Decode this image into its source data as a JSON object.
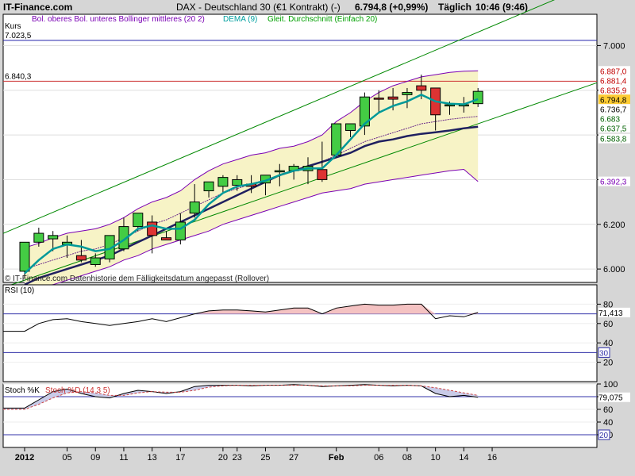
{
  "header": {
    "site": "IT-Finance.com",
    "instrument": "DAX - Deutschland 30 (€1 Kontrakt) (-)",
    "quote": "6.794,8 (+0,99%)",
    "timeframe": "Täglich",
    "time": "10:46 (9:46)"
  },
  "price_panel": {
    "ylabel": "Kurs",
    "legend": [
      {
        "text": "Bol. oberes Bol. unteres Bollinger mittleres (20 2)",
        "color": "#7a00b4"
      },
      {
        "text": "DEMA (9)",
        "color": "#00a0a0"
      },
      {
        "text": "Gleit. Durchschnitt (Einfach 20)",
        "color": "#00a000"
      }
    ],
    "hline_upper_label": "7.023,5",
    "hline_lower_label": "6.840,3",
    "copyright": "© IT-Finance.com  Datenhistorie dem Fälligkeitsdatum angepasst (Rollover)",
    "right_labels": [
      {
        "text": "6.887,0",
        "value": 6887.0,
        "bg": "#ffffff",
        "fg": "#c00000"
      },
      {
        "text": "6.881,4",
        "value": 6881.4,
        "bg": "#ffffff",
        "fg": "#c00000"
      },
      {
        "text": "6.835,9",
        "value": 6835.9,
        "bg": "#ffffff",
        "fg": "#c00000"
      },
      {
        "text": "6.794,8",
        "value": 6794.8,
        "bg": "#ffcc33",
        "fg": "#000000"
      },
      {
        "text": "6.736,7",
        "value": 6736.7,
        "bg": "#ffffff",
        "fg": "#000000"
      },
      {
        "text": "6.683",
        "value": 6683.0,
        "bg": "#ffffff",
        "fg": "#006000"
      },
      {
        "text": "6.637,5",
        "value": 6637.5,
        "bg": "#ffffff",
        "fg": "#006000"
      },
      {
        "text": "6.583,8",
        "value": 6583.8,
        "bg": "#ffffff",
        "fg": "#006000"
      },
      {
        "text": "6.392,3",
        "value": 6392.3,
        "bg": "#ffffff",
        "fg": "#7a00b4"
      }
    ]
  },
  "rsi_panel": {
    "label": "RSI (10)",
    "value_label": "71,413",
    "level_label": "30"
  },
  "stoch_panel": {
    "label_k": "Stoch %K",
    "label_d": "Stoch %D (14 3 5)",
    "value_label": "79,075",
    "level_label": "20"
  },
  "colors": {
    "up": "#44cc44",
    "down": "#dd3333",
    "bollinger": "#7a00b4",
    "dema": "#009999",
    "channel": "#008800",
    "band_fill": "#f7f3c6"
  },
  "chart_data": [
    {
      "type": "candlestick",
      "title": "DAX - Deutschland 30 (€1 Kontrakt) (-)",
      "ylabel": "Kurs",
      "yaxis_ticks": [
        6000,
        6200,
        6400,
        6600,
        6800,
        7000
      ],
      "yaxis_tick_labels": [
        "6.000",
        "6.200",
        "",
        "",
        "",
        "7.000"
      ],
      "ylim": [
        5940,
        7140
      ],
      "xaxis_tick_labels": [
        "2012",
        "05",
        "09",
        "11",
        "13",
        "17",
        "20",
        "23",
        "25",
        "27",
        "Feb",
        "06",
        "08",
        "10",
        "14",
        "16"
      ],
      "dates": [
        "2012-01-02",
        "2012-01-03",
        "2012-01-04",
        "2012-01-05",
        "2012-01-06",
        "2012-01-09",
        "2012-01-10",
        "2012-01-11",
        "2012-01-12",
        "2012-01-13",
        "2012-01-16",
        "2012-01-17",
        "2012-01-18",
        "2012-01-19",
        "2012-01-20",
        "2012-01-23",
        "2012-01-24",
        "2012-01-25",
        "2012-01-26",
        "2012-01-27",
        "2012-01-30",
        "2012-01-31",
        "2012-02-01",
        "2012-02-02",
        "2012-02-03",
        "2012-02-06",
        "2012-02-07",
        "2012-02-08",
        "2012-02-09",
        "2012-02-10",
        "2012-02-13",
        "2012-02-14",
        "2012-02-15"
      ],
      "open": [
        5990,
        6120,
        6135,
        6110,
        6060,
        6020,
        6045,
        6090,
        6190,
        6210,
        6140,
        6130,
        6250,
        6350,
        6370,
        6375,
        6380,
        6385,
        6440,
        6440,
        6440,
        6445,
        6510,
        6620,
        6640,
        6765,
        6770,
        6780,
        6820,
        6810,
        6730,
        6730,
        6740
      ],
      "high": [
        6080,
        6185,
        6170,
        6150,
        6130,
        6070,
        6150,
        6230,
        6230,
        6240,
        6170,
        6250,
        6380,
        6390,
        6420,
        6420,
        6420,
        6410,
        6470,
        6470,
        6500,
        6570,
        6650,
        6650,
        6790,
        6800,
        6810,
        6810,
        6870,
        6810,
        6750,
        6770,
        6810
      ],
      "low": [
        5960,
        6100,
        6080,
        6050,
        6030,
        6010,
        6030,
        6080,
        6170,
        6070,
        6130,
        6110,
        6230,
        6320,
        6340,
        6350,
        6340,
        6330,
        6370,
        6400,
        6380,
        6390,
        6500,
        6590,
        6600,
        6700,
        6710,
        6720,
        6760,
        6620,
        6690,
        6700,
        6725
      ],
      "close": [
        6120,
        6160,
        6150,
        6120,
        6040,
        6050,
        6150,
        6190,
        6250,
        6150,
        6130,
        6210,
        6300,
        6390,
        6410,
        6400,
        6370,
        6420,
        6440,
        6460,
        6460,
        6400,
        6650,
        6650,
        6770,
        6760,
        6760,
        6790,
        6800,
        6690,
        6735,
        6735,
        6795
      ],
      "bollinger_upper_label": "Bol. oberes",
      "bollinger_lower_label": "Bol. unteres",
      "bollinger_upper": [
        6095,
        6115,
        6140,
        6160,
        6170,
        6180,
        6200,
        6230,
        6270,
        6300,
        6320,
        6350,
        6400,
        6440,
        6470,
        6490,
        6510,
        6520,
        6540,
        6550,
        6570,
        6600,
        6660,
        6700,
        6750,
        6790,
        6820,
        6840,
        6860,
        6870,
        6880,
        6885,
        6887
      ],
      "bollinger_mid": [
        6000,
        6020,
        6040,
        6060,
        6080,
        6090,
        6110,
        6140,
        6170,
        6200,
        6220,
        6250,
        6280,
        6310,
        6340,
        6360,
        6380,
        6400,
        6420,
        6440,
        6460,
        6480,
        6510,
        6540,
        6570,
        6590,
        6610,
        6630,
        6650,
        6660,
        6670,
        6677,
        6683
      ],
      "bollinger_lower": [
        5900,
        5920,
        5930,
        5950,
        5970,
        5990,
        6010,
        6040,
        6060,
        6090,
        6110,
        6130,
        6150,
        6170,
        6200,
        6220,
        6240,
        6260,
        6280,
        6300,
        6320,
        6340,
        6350,
        6360,
        6380,
        6390,
        6400,
        6410,
        6420,
        6430,
        6440,
        6446,
        6392
      ],
      "dema": [
        5980,
        6040,
        6090,
        6110,
        6100,
        6080,
        6090,
        6130,
        6180,
        6195,
        6180,
        6180,
        6220,
        6290,
        6340,
        6370,
        6380,
        6395,
        6420,
        6440,
        6450,
        6450,
        6510,
        6580,
        6650,
        6700,
        6730,
        6750,
        6780,
        6750,
        6740,
        6737,
        6760
      ],
      "sma20": [
        5930,
        5960,
        5980,
        6000,
        6020,
        6040,
        6060,
        6090,
        6120,
        6150,
        6180,
        6210,
        6240,
        6270,
        6300,
        6330,
        6360,
        6390,
        6420,
        6440,
        6460,
        6480,
        6500,
        6520,
        6550,
        6570,
        6580,
        6595,
        6605,
        6612,
        6620,
        6630,
        6637
      ],
      "channel_upper": {
        "x": [
          "2012-01-02",
          "2012-02-15"
        ],
        "y": [
          6200,
          7060
        ]
      },
      "channel_lower": {
        "x": [
          "2012-01-02",
          "2012-02-15"
        ],
        "y": [
          5950,
          6650
        ]
      },
      "hlines": [
        7023.5,
        6840.3
      ]
    },
    {
      "type": "line",
      "title": "RSI (10)",
      "ylim": [
        0,
        100
      ],
      "yaxis_ticks": [
        20,
        40,
        60,
        80
      ],
      "values": [
        52,
        60,
        64,
        65,
        62,
        60,
        58,
        60,
        62,
        65,
        62,
        66,
        70,
        73,
        74,
        74,
        73,
        72,
        74,
        76,
        76,
        70,
        76,
        78,
        80,
        79,
        79,
        80,
        80,
        65,
        68,
        67,
        71.413
      ],
      "levels": [
        70,
        30
      ]
    },
    {
      "type": "line",
      "title": "Stoch %K / Stoch %D (14 3 5)",
      "series": [
        {
          "name": "Stoch %K",
          "values": [
            62,
            75,
            88,
            92,
            85,
            80,
            78,
            85,
            90,
            88,
            85,
            88,
            96,
            98,
            98,
            98,
            97,
            98,
            98,
            99,
            98,
            96,
            97,
            98,
            99,
            98,
            97,
            98,
            97,
            85,
            80,
            82,
            79.075
          ]
        },
        {
          "name": "Stoch %D (14 3 5)",
          "values": [
            60,
            68,
            78,
            86,
            88,
            86,
            82,
            82,
            86,
            88,
            87,
            87,
            90,
            95,
            97,
            98,
            98,
            98,
            98,
            98,
            98,
            97,
            97,
            97,
            98,
            98,
            98,
            98,
            97,
            94,
            90,
            86,
            82
          ]
        }
      ],
      "ylim": [
        0,
        100
      ],
      "yaxis_ticks": [
        20,
        40,
        60,
        80,
        100
      ],
      "levels": [
        80,
        20
      ]
    }
  ]
}
